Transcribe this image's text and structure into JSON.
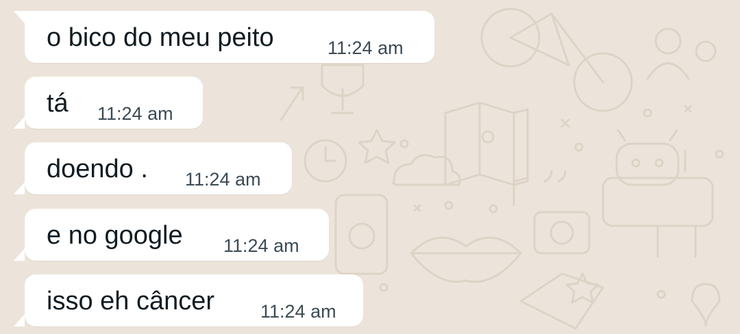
{
  "chat": {
    "background_color": "#ece4da",
    "bubble_color": "#ffffff",
    "messages": [
      {
        "text": "o bico do meu peito",
        "time": "11:24 am",
        "direction": "incoming"
      },
      {
        "text": "tá",
        "time": "11:24 am",
        "direction": "incoming"
      },
      {
        "text": "doendo .",
        "time": "11:24 am",
        "direction": "incoming"
      },
      {
        "text": "e no google",
        "time": "11:24 am",
        "direction": "incoming"
      },
      {
        "text": "isso eh câncer",
        "time": "11:24 am",
        "direction": "incoming"
      }
    ]
  }
}
